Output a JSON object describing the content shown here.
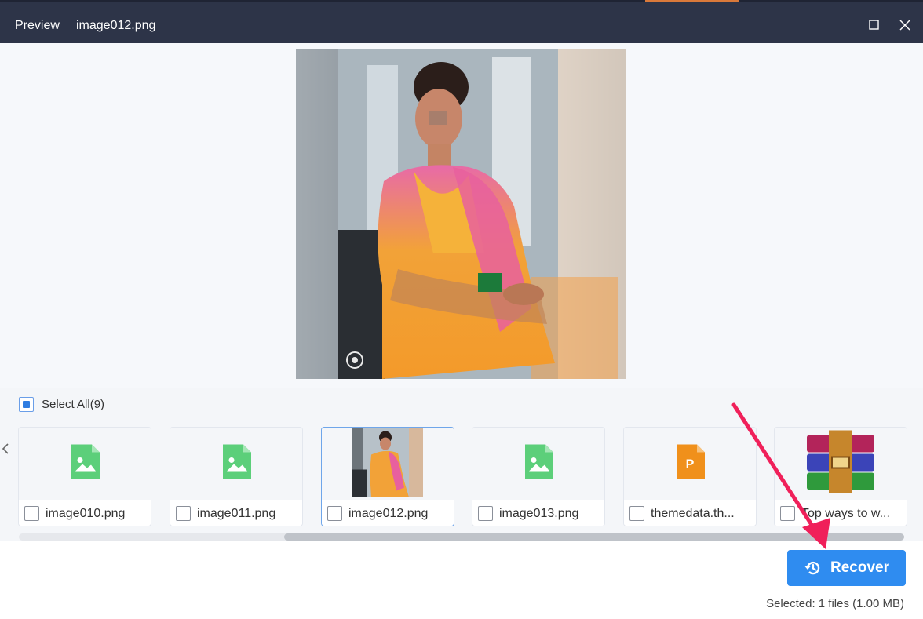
{
  "titlebar": {
    "preview_label": "Preview",
    "file_name": "image012.png"
  },
  "preview": {
    "image_name": "image012.png"
  },
  "select_all": {
    "label": "Select All(9)",
    "checked": true
  },
  "files": [
    {
      "name": "image010.png",
      "type": "image-icon",
      "selected": false
    },
    {
      "name": "image011.png",
      "type": "image-icon",
      "selected": false
    },
    {
      "name": "image012.png",
      "type": "photo-thumbnail",
      "selected": true
    },
    {
      "name": "image013.png",
      "type": "image-icon",
      "selected": false
    },
    {
      "name": "themedata.th...",
      "type": "powerpoint-icon",
      "selected": false
    },
    {
      "name": "Top ways to w...",
      "type": "winrar-icon",
      "selected": false
    }
  ],
  "actions": {
    "recover_label": "Recover"
  },
  "status": {
    "selected_text": "Selected: 1 files (1.00 MB)"
  },
  "colors": {
    "titlebar": "#2d3448",
    "accent_button": "#2f8cf0",
    "image_icon": "#5ccf7a",
    "ppt_icon": "#f0901b",
    "annotation_arrow": "#f0205a"
  }
}
